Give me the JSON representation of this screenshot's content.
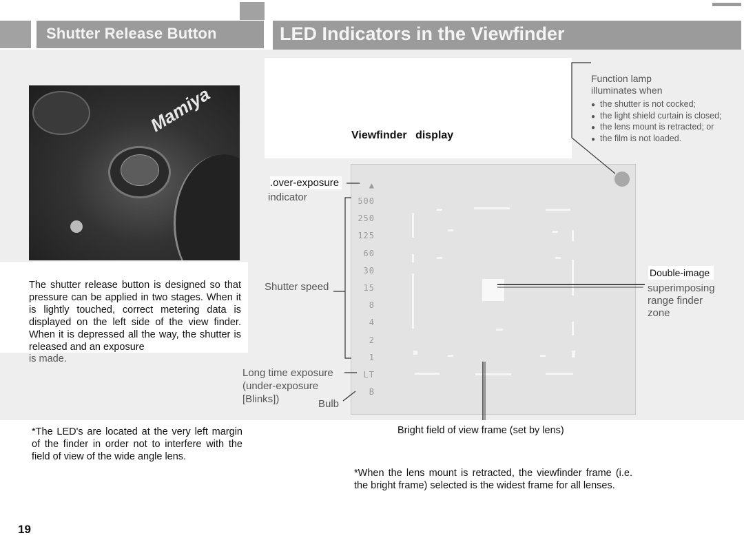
{
  "headers": {
    "left_title": "Shutter Release Button",
    "right_title": "LED Indicators in the Viewfinder"
  },
  "photo": {
    "alt": "Close-up of camera shutter release button",
    "brand_text": "Mamiya"
  },
  "left_column": {
    "intro_text": "The shutter release button is designed so that pressure can be applied in two stages. When it is lightly touched, correct metering data is displayed on the left side of the view finder. When it is depressed all the way, the shutter is released and an exposure",
    "intro_last_line": "is made.",
    "led_note": "*The LED's are located at the very left margin of the finder in order not to interfere with the field of view of the wide angle lens."
  },
  "viewfinder": {
    "title": "Viewfinder display",
    "led_scale": [
      "500",
      "250",
      "125",
      "60",
      "30",
      "15",
      "8",
      "4",
      "2",
      "1",
      "LT",
      "B"
    ],
    "labels": {
      "over_exposure_1": ".over-exposure",
      "over_exposure_2": "indicator",
      "shutter_speed": "Shutter speed",
      "long_time_1": "Long time exposure",
      "long_time_2": "(under-exposure",
      "long_time_3": "[Blinks])",
      "bulb": "Bulb",
      "double_image": "Double-image",
      "superimposing": "superimposing",
      "range_finder": "range finder",
      "zone": "zone",
      "bright_field": "Bright field of view frame (set by lens)"
    },
    "function_lamp": {
      "title_1": "Function lamp",
      "title_2": "illuminates when",
      "conditions": [
        "the shutter is not cocked;",
        "the light shield curtain is closed;",
        "the lens mount is retracted; or",
        "the film is not loaded."
      ]
    }
  },
  "right_column": {
    "lens_note": "*When the lens mount is retracted, the viewfinder frame (i.e. the bright frame) selected is the widest frame for all lenses."
  },
  "page_number": "19"
}
